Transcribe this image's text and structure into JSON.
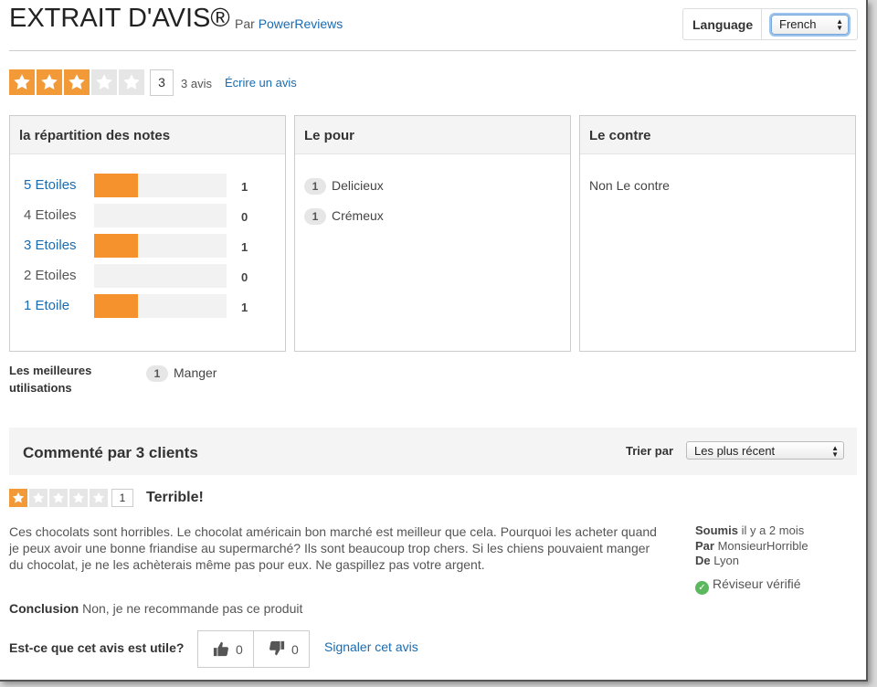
{
  "header": {
    "title": "EXTRAIT D'AVIS®",
    "by_prefix": "Par",
    "by_link": "PowerReviews",
    "language_label": "Language",
    "language_value": "French"
  },
  "summary": {
    "rating": 3,
    "max_rating": 5,
    "count": "3",
    "count_text": "3 avis",
    "write_link": "Écrire un avis"
  },
  "distribution": {
    "title": "la répartition des notes",
    "rows": [
      {
        "label": "5 Etoiles",
        "count": "1",
        "fraction": 0.33,
        "link": true
      },
      {
        "label": "4 Etoiles",
        "count": "0",
        "fraction": 0,
        "link": false
      },
      {
        "label": "3 Etoiles",
        "count": "1",
        "fraction": 0.33,
        "link": true
      },
      {
        "label": "2 Etoiles",
        "count": "0",
        "fraction": 0,
        "link": false
      },
      {
        "label": "1 Etoile",
        "count": "1",
        "fraction": 0.33,
        "link": true
      }
    ]
  },
  "pros": {
    "title": "Le pour",
    "items": [
      {
        "count": "1",
        "label": "Delicieux"
      },
      {
        "count": "1",
        "label": "Crémeux"
      }
    ]
  },
  "cons": {
    "title": "Le contre",
    "empty_text": "Non Le contre"
  },
  "best_uses": {
    "label": "Les meilleures utilisations",
    "items": [
      {
        "count": "1",
        "label": "Manger"
      }
    ]
  },
  "reviews_bar": {
    "title": "Commenté par 3 clients",
    "sort_label": "Trier par",
    "sort_value": "Les plus récent"
  },
  "review": {
    "rating": 1,
    "rating_text": "1",
    "title": "Terrible!",
    "body": "Ces chocolats sont horribles. Le chocolat américain bon marché est meilleur que cela. Pourquoi les acheter quand je peux avoir une bonne friandise au supermarché? Ils sont beaucoup trop chers. Si les chiens pouvaient manger du chocolat, je ne les achèterais même pas pour eux. Ne gaspillez pas votre argent.",
    "submitted_label": "Soumis",
    "submitted_value": "il y a 2 mois",
    "author_label": "Par",
    "author_value": "MonsieurHorrible",
    "location_label": "De",
    "location_value": "Lyon",
    "verified": "Réviseur vérifié",
    "conclusion_label": "Conclusion",
    "conclusion_value": "Non, je ne recommande pas ce produit",
    "helpful_question": "Est-ce que cet avis est utile?",
    "helpful_yes": "0",
    "helpful_no": "0",
    "report_link": "Signaler cet avis"
  },
  "colors": {
    "star": "#f29a38",
    "bar_fill": "#f5922e",
    "link": "#1a6bb0",
    "verified": "#5cb85c"
  }
}
